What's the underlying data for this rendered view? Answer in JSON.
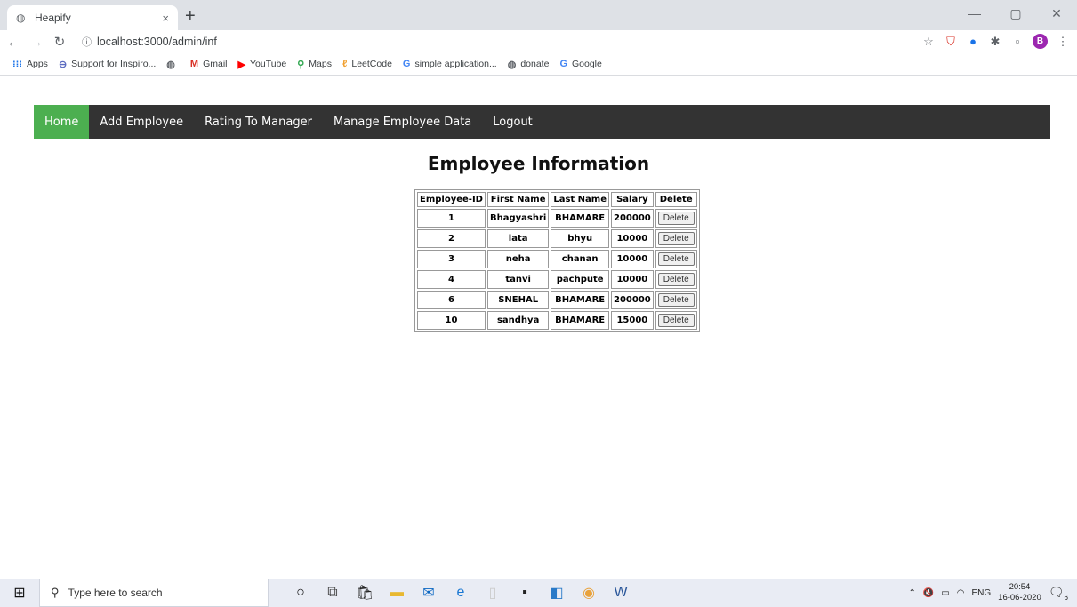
{
  "browser": {
    "tab_title": "Heapify",
    "tab_close": "×",
    "new_tab": "+",
    "url": "localhost:3000/admin/inf",
    "window_controls": [
      "—",
      "▢",
      "✕"
    ],
    "avatar_letter": "B",
    "bookmarks": [
      {
        "icon": "apps-grid-icon",
        "label": "Apps"
      },
      {
        "icon": "globe-icon",
        "label": "Support for Inspiro..."
      },
      {
        "icon": "globe-icon",
        "label": ""
      },
      {
        "icon": "gmail-icon",
        "label": "Gmail"
      },
      {
        "icon": "youtube-icon",
        "label": "YouTube"
      },
      {
        "icon": "maps-icon",
        "label": "Maps"
      },
      {
        "icon": "leetcode-icon",
        "label": "LeetCode"
      },
      {
        "icon": "google-icon",
        "label": "simple application..."
      },
      {
        "icon": "globe-icon",
        "label": "donate"
      },
      {
        "icon": "google-icon",
        "label": "Google"
      }
    ]
  },
  "nav": {
    "items": [
      "Home",
      "Add Employee",
      "Rating To Manager",
      "Manage Employee Data",
      "Logout"
    ],
    "active": "Home",
    "active_color": "#4caf50",
    "bar_color": "#333333"
  },
  "page": {
    "title": "Employee Information"
  },
  "table": {
    "headers": [
      "Employee-ID",
      "First Name",
      "Last Name",
      "Salary",
      "Delete"
    ],
    "delete_label": "Delete",
    "rows": [
      [
        "1",
        "Bhagyashri",
        "BHAMARE",
        "200000"
      ],
      [
        "2",
        "lata",
        "bhyu",
        "10000"
      ],
      [
        "3",
        "neha",
        "chanan",
        "10000"
      ],
      [
        "4",
        "tanvi",
        "pachpute",
        "10000"
      ],
      [
        "6",
        "SNEHAL",
        "BHAMARE",
        "200000"
      ],
      [
        "10",
        "sandhya",
        "BHAMARE",
        "15000"
      ]
    ]
  },
  "taskbar": {
    "search_placeholder": "Type here to search",
    "lang": "ENG",
    "time": "20:54",
    "date": "16-06-2020",
    "notifications": "6"
  }
}
